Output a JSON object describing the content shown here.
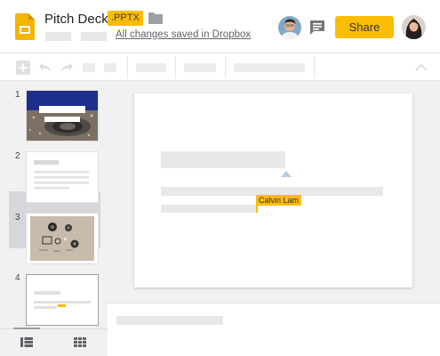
{
  "document": {
    "title": "Pitch Deck",
    "format_badge": ".PPTX",
    "save_status": "All changes saved in Dropbox"
  },
  "header": {
    "share_label": "Share",
    "icons": [
      "slides-app-icon",
      "folder-icon",
      "comment-icon"
    ]
  },
  "collaborator_cursor": {
    "name": "Calvin Lam",
    "color": "#fbbc04"
  },
  "slides": [
    {
      "number": "1"
    },
    {
      "number": "2"
    },
    {
      "number": "3"
    },
    {
      "number": "4"
    }
  ],
  "selected_slide": "4",
  "colors": {
    "accent": "#fbbc04",
    "rail_background": "#f1f1f1",
    "selected_slide": "#d5d7da"
  }
}
